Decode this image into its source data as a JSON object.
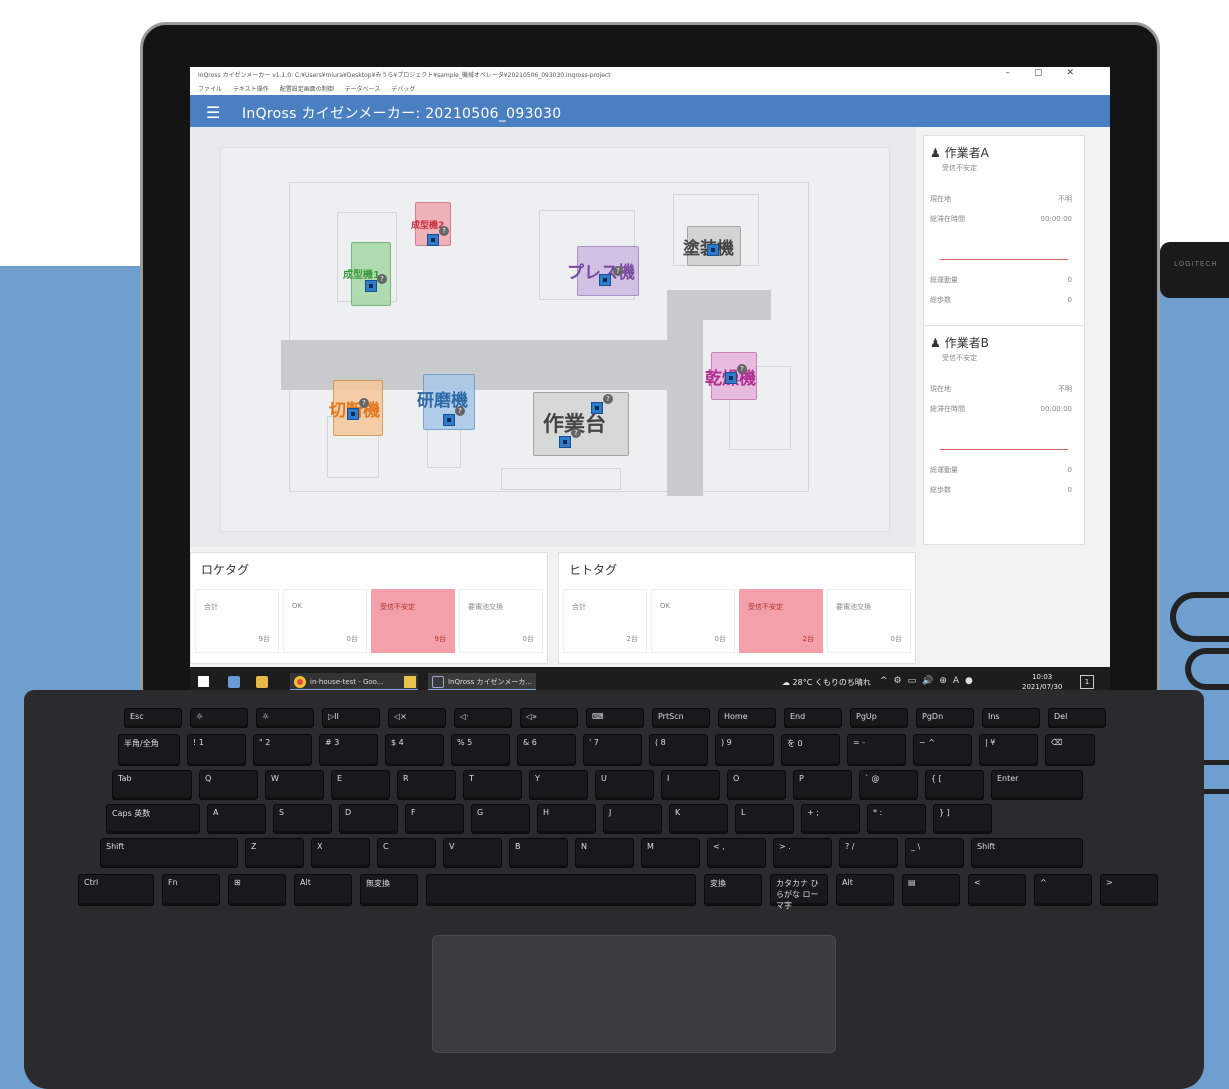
{
  "window": {
    "path_title": "InQross カイゼンメーカー v1.1.0: C:¥Users¥miura¥Desktop¥みうら¥プロジェクト¥sample_機械オペレータ¥20210506_093030.inqross-project",
    "menus": [
      "ファイル",
      "テキスト操作",
      "配置設定画面の制御",
      "データベース",
      "デバッグ"
    ],
    "app_title": "InQross カイゼンメーカー: 20210506_093030"
  },
  "map": {
    "machines": [
      {
        "label": "成型機1",
        "color": "#3a9a3a"
      },
      {
        "label": "成型機2",
        "color": "#c83040"
      },
      {
        "label": "プレス機",
        "color": "#7a4aa0"
      },
      {
        "label": "塗装機",
        "color": "#444444"
      },
      {
        "label": "乾燥機",
        "color": "#b03090"
      },
      {
        "label": "切断機",
        "color": "#e07820"
      },
      {
        "label": "研磨機",
        "color": "#2e6aa8"
      },
      {
        "label": "作業台",
        "color": "#444444"
      }
    ],
    "unknown_mark": "?"
  },
  "workers": [
    {
      "name": "作業者A",
      "status": "受信不安定",
      "location_label": "現在地",
      "location_value": "不明",
      "stay_label": "総滞在時間",
      "stay_value": "00:00:00",
      "move_label": "総運動量",
      "move_value": "0",
      "steps_label": "総歩数",
      "steps_value": "0"
    },
    {
      "name": "作業者B",
      "status": "受信不安定",
      "location_label": "現在地",
      "location_value": "不明",
      "stay_label": "総滞在時間",
      "stay_value": "00:00:00",
      "move_label": "総運動量",
      "move_value": "0",
      "steps_label": "総歩数",
      "steps_value": "0"
    }
  ],
  "loca_tag": {
    "title": "ロケタグ",
    "cells": [
      {
        "label": "合計",
        "value": "9台"
      },
      {
        "label": "OK",
        "value": "0台"
      },
      {
        "label": "受信不安定",
        "value": "9台"
      },
      {
        "label": "要電池交換",
        "value": "0台"
      }
    ]
  },
  "hito_tag": {
    "title": "ヒトタグ",
    "cells": [
      {
        "label": "合計",
        "value": "2台"
      },
      {
        "label": "OK",
        "value": "0台"
      },
      {
        "label": "受信不安定",
        "value": "2台"
      },
      {
        "label": "要電池交換",
        "value": "0台"
      }
    ]
  },
  "taskbar": {
    "chrome_label": "in-house-test - Goo...",
    "app_label": "InQross カイゼンメーカ...",
    "weather": "28°C くもりのち晴れ",
    "time": "10:03",
    "date": "2021/07/30",
    "notif_count": "1"
  },
  "keyboard": {
    "fn_row": [
      "Esc",
      "☼",
      "☼",
      "▷II",
      "◁×",
      "◁·",
      "◁»",
      "⌨",
      "PrtScn",
      "Home",
      "End",
      "PgUp",
      "PgDn",
      "Ins",
      "Del"
    ],
    "num_row": [
      "半角/全角",
      "! 1",
      "\" 2",
      "# 3",
      "$ 4",
      "% 5",
      "& 6",
      "' 7",
      "( 8",
      ") 9",
      "を 0",
      "= -",
      "~ ^",
      "| ¥",
      "⌫"
    ],
    "q_row": [
      "Tab",
      "Q",
      "W",
      "E",
      "R",
      "T",
      "Y",
      "U",
      "I",
      "O",
      "P",
      "` @",
      "{ [",
      "Enter"
    ],
    "a_row": [
      "Caps 英数",
      "A",
      "S",
      "D",
      "F",
      "G",
      "H",
      "J",
      "K",
      "L",
      "+ ;",
      "* :",
      "} ]"
    ],
    "z_row": [
      "Shift",
      "Z",
      "X",
      "C",
      "V",
      "B",
      "N",
      "M",
      "< ,",
      "> .",
      "? /",
      "_ \\",
      "Shift"
    ],
    "bottom_row": [
      "Ctrl",
      "Fn",
      "⊞",
      "Alt",
      "無変換",
      "",
      "変換",
      "カタカナ ひらがな ローマ字",
      "Alt",
      "▤",
      "<",
      "^",
      ">"
    ]
  },
  "usb_label": "LOGITECH"
}
